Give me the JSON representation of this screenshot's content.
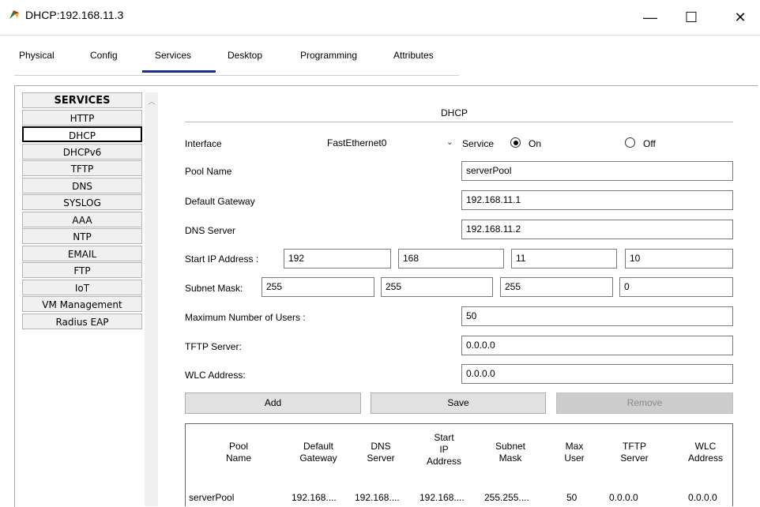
{
  "window": {
    "title": "DHCP:192.168.11.3",
    "controls": {
      "minimize": "—",
      "maximize": "☐",
      "close": "✕"
    }
  },
  "tabs": [
    "Physical",
    "Config",
    "Services",
    "Desktop",
    "Programming",
    "Attributes"
  ],
  "active_tab": "Services",
  "sidebar": {
    "header": "SERVICES",
    "items": [
      "HTTP",
      "DHCP",
      "DHCPv6",
      "TFTP",
      "DNS",
      "SYSLOG",
      "AAA",
      "NTP",
      "EMAIL",
      "FTP",
      "IoT",
      "VM Management",
      "Radius EAP"
    ],
    "active": "DHCP"
  },
  "panel": {
    "title": "DHCP",
    "interface_label": "Interface",
    "interface_value": "FastEthernet0",
    "service_label": "Service",
    "on_label": "On",
    "off_label": "Off",
    "service_state": "On",
    "pool_name_label": "Pool Name",
    "pool_name_value": "serverPool",
    "default_gateway_label": "Default Gateway",
    "default_gateway_value": "192.168.11.1",
    "dns_server_label": "DNS Server",
    "dns_server_value": "192.168.11.2",
    "start_ip_label": "Start IP Address :",
    "start_ip": [
      "192",
      "168",
      "11",
      "10"
    ],
    "subnet_mask_label": "Subnet Mask:",
    "subnet_mask": [
      "255",
      "255",
      "255",
      "0"
    ],
    "max_users_label": "Maximum Number of Users :",
    "max_users_value": "50",
    "tftp_label": "TFTP Server:",
    "tftp_value": "0.0.0.0",
    "wlc_label": "WLC Address:",
    "wlc_value": "0.0.0.0",
    "buttons": {
      "add": "Add",
      "save": "Save",
      "remove": "Remove"
    }
  },
  "table": {
    "headers": [
      [
        "Pool",
        "Name"
      ],
      [
        "Default",
        "Gateway"
      ],
      [
        "DNS",
        "Server"
      ],
      [
        "Start",
        "IP",
        "Address"
      ],
      [
        "Subnet",
        "Mask"
      ],
      [
        "Max",
        "User"
      ],
      [
        "TFTP",
        "Server"
      ],
      [
        "WLC",
        "Address"
      ]
    ],
    "rows": [
      [
        "serverPool",
        "192.168....",
        "192.168....",
        "192.168....",
        "255.255....",
        "50",
        "0.0.0.0",
        "0.0.0.0"
      ]
    ]
  },
  "colors": {
    "tab_underline": "#1e2a8c",
    "disabled_button": "#cccccc"
  }
}
